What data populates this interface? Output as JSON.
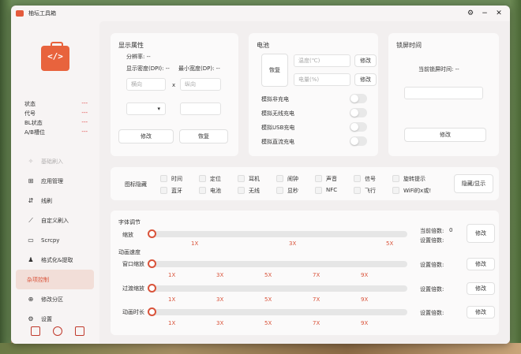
{
  "window": {
    "title": "柚坛工具箱",
    "settings_icon": "gear-icon",
    "min": "−",
    "close": "✕"
  },
  "logo": {
    "glyph": "</>"
  },
  "status": [
    {
      "k": "状态",
      "v": "---"
    },
    {
      "k": "代号",
      "v": "---"
    },
    {
      "k": "BL状态",
      "v": "---"
    },
    {
      "k": "A/B槽位",
      "v": "---"
    }
  ],
  "nav": [
    {
      "label": "基础刷入"
    },
    {
      "label": "应用管理"
    },
    {
      "label": "线刷"
    },
    {
      "label": "自定义刷入"
    },
    {
      "label": "Scrcpy"
    },
    {
      "label": "格式化&提取"
    },
    {
      "label": "杂项控制"
    },
    {
      "label": "修改分区"
    },
    {
      "label": "设置"
    }
  ],
  "display": {
    "title": "显示属性",
    "resolution": "分辨率:",
    "resolution_v": "--",
    "dpi": "显示密度(DPI):",
    "dpi_v": "--",
    "min_width": "最小宽度(DP):",
    "min_width_v": "--",
    "ph_h": "横向",
    "x": "x",
    "ph_v": "纵向",
    "modify": "修改",
    "restore": "恢复"
  },
  "battery": {
    "title": "电池",
    "restore": "恢复",
    "temp_ph": "温度(℃)",
    "level_ph": "电量(%)",
    "modify": "修改",
    "modify2": "修改",
    "opts": [
      "模拟非充电",
      "模拟无线充电",
      "模拟USB充电",
      "模拟直流充电"
    ]
  },
  "lock": {
    "title": "锁屏时间",
    "current": "当前锁屏时间:",
    "current_v": "--",
    "modify": "修改"
  },
  "icons": {
    "title": "图标隐藏",
    "row1": [
      "时间",
      "定位",
      "耳机",
      "闹钟",
      "声音",
      "信号",
      "旋转提示"
    ],
    "row2": [
      "蓝牙",
      "电池",
      "无线",
      "显秒",
      "NFC",
      "飞行",
      "WiFi的x或!"
    ],
    "button": "隐藏/显示"
  },
  "font": {
    "title": "字体调节",
    "scale": "缩放",
    "ticks": [
      "1X",
      "3X",
      "5X"
    ],
    "current": "当前倍数:",
    "current_v": "0",
    "set": "设置倍数:",
    "modify": "修改"
  },
  "anim": {
    "title": "动画速度",
    "rows": [
      {
        "label": "窗口缩放",
        "set": "设置倍数:",
        "modify": "修改"
      },
      {
        "label": "过渡缩放",
        "set": "设置倍数:",
        "modify": "修改"
      },
      {
        "label": "动画时长",
        "set": "设置倍数:",
        "modify": "修改"
      }
    ],
    "ticks": [
      "1X",
      "3X",
      "5X",
      "7X",
      "9X"
    ]
  }
}
